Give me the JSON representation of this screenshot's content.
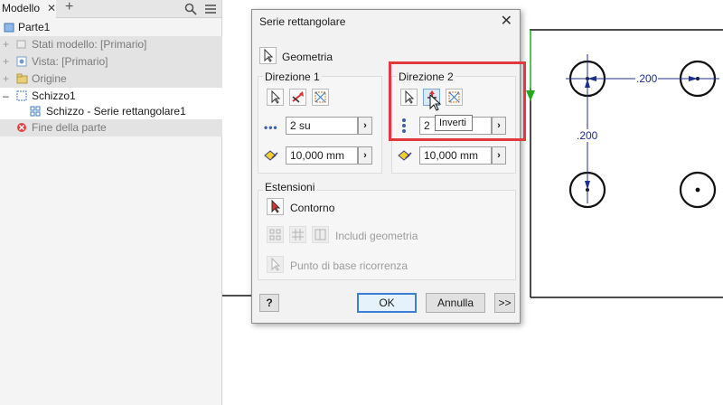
{
  "browser": {
    "tab_label": "Modello",
    "tab_close": "✕",
    "add_tab": "+",
    "items": [
      {
        "label": "Parte1"
      },
      {
        "label": "Stati modello: [Primario]"
      },
      {
        "label": "Vista: [Primario]"
      },
      {
        "label": "Origine"
      },
      {
        "label": "Schizzo1"
      },
      {
        "label": "Schizzo - Serie rettangolare1"
      },
      {
        "label": "Fine della parte"
      }
    ]
  },
  "dialog": {
    "title": "Serie rettangolare",
    "close": "✕",
    "geometry_label": "Geometria",
    "dir1": {
      "label": "Direzione 1",
      "count": "2 su",
      "spacing": "10,000 mm"
    },
    "dir2": {
      "label": "Direzione 2",
      "count": "2",
      "spacing": "10,000 mm"
    },
    "field_arrow": "›",
    "tooltip": "Inverti",
    "extensions": {
      "label": "Estensioni",
      "contour": "Contorno",
      "include_geometry": "Includi geometria",
      "base_point": "Punto di base ricorrenza"
    },
    "ok": "OK",
    "cancel": "Annulla",
    "more": ">>",
    "help": "?"
  },
  "sketch": {
    "dim_horizontal": ".200",
    "dim_vertical": ".200"
  },
  "colors": {
    "highlight": "#e03a3e",
    "sketch_blue": "#1f2f8f",
    "axis_green": "#22aa22"
  }
}
